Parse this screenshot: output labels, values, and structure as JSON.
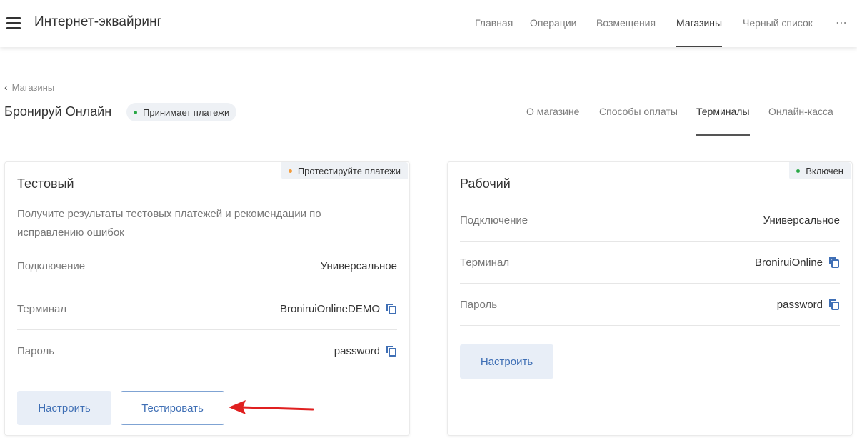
{
  "header": {
    "app_title": "Интернет-эквайринг",
    "nav": [
      "Главная",
      "Операции",
      "Возмещения",
      "Магазины",
      "Черный список"
    ],
    "active_nav": "Магазины",
    "more": "⋯"
  },
  "breadcrumb": {
    "label": "Магазины"
  },
  "store": {
    "name": "Бронируй Онлайн",
    "status": "Принимает платежи",
    "tabs": [
      "О магазине",
      "Способы оплаты",
      "Терминалы",
      "Онлайн-касса"
    ],
    "active_tab": "Терминалы"
  },
  "cards": {
    "test": {
      "badge": "Протестируйте платежи",
      "title": "Тестовый",
      "description": "Получите результаты тестовых платежей и рекомендации по исправлению ошибок",
      "rows": [
        {
          "label": "Подключение",
          "value": "Универсальное"
        },
        {
          "label": "Терминал",
          "value": "BroniruiOnlineDEMO"
        },
        {
          "label": "Пароль",
          "value": "password"
        }
      ],
      "btn_configure": "Настроить",
      "btn_test": "Тестировать"
    },
    "prod": {
      "badge": "Включен",
      "title": "Рабочий",
      "rows": [
        {
          "label": "Подключение",
          "value": "Универсальное"
        },
        {
          "label": "Терминал",
          "value": "BroniruiOnline"
        },
        {
          "label": "Пароль",
          "value": "password"
        }
      ],
      "btn_configure": "Настроить"
    }
  },
  "colors": {
    "accent_blue": "#3f6fb5",
    "status_green": "#28a745",
    "status_orange": "#f39c3c",
    "annotation_red": "#e02020"
  }
}
